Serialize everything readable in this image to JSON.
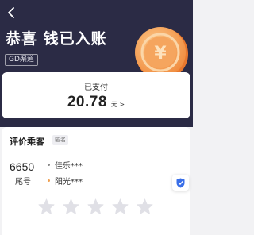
{
  "header": {
    "title": "恭喜 钱已入账",
    "channel_badge": "GD渠道",
    "coin_symbol": "¥",
    "background_color": "#2b2b45"
  },
  "payment": {
    "status_label": "已支付",
    "amount": "20.78",
    "unit": "元 >"
  },
  "rating": {
    "title": "评价乘客",
    "anonymous_tag": "匿名",
    "tail_number": "6650",
    "tail_label": "尾号",
    "passengers": [
      {
        "name": "佳乐***",
        "dot_color": "#888888"
      },
      {
        "name": "阳光***",
        "dot_color": "#f0a050"
      }
    ],
    "stars_filled": 0,
    "stars_total": 5,
    "star_color": "#e0e0e6"
  },
  "icons": {
    "back": "back-arrow-icon",
    "coin": "yuan-coin-icon",
    "shield": "shield-icon",
    "star": "star-icon"
  },
  "colors": {
    "shield_blue": "#3a6fe8",
    "coin_orange": "#f7a85c"
  }
}
